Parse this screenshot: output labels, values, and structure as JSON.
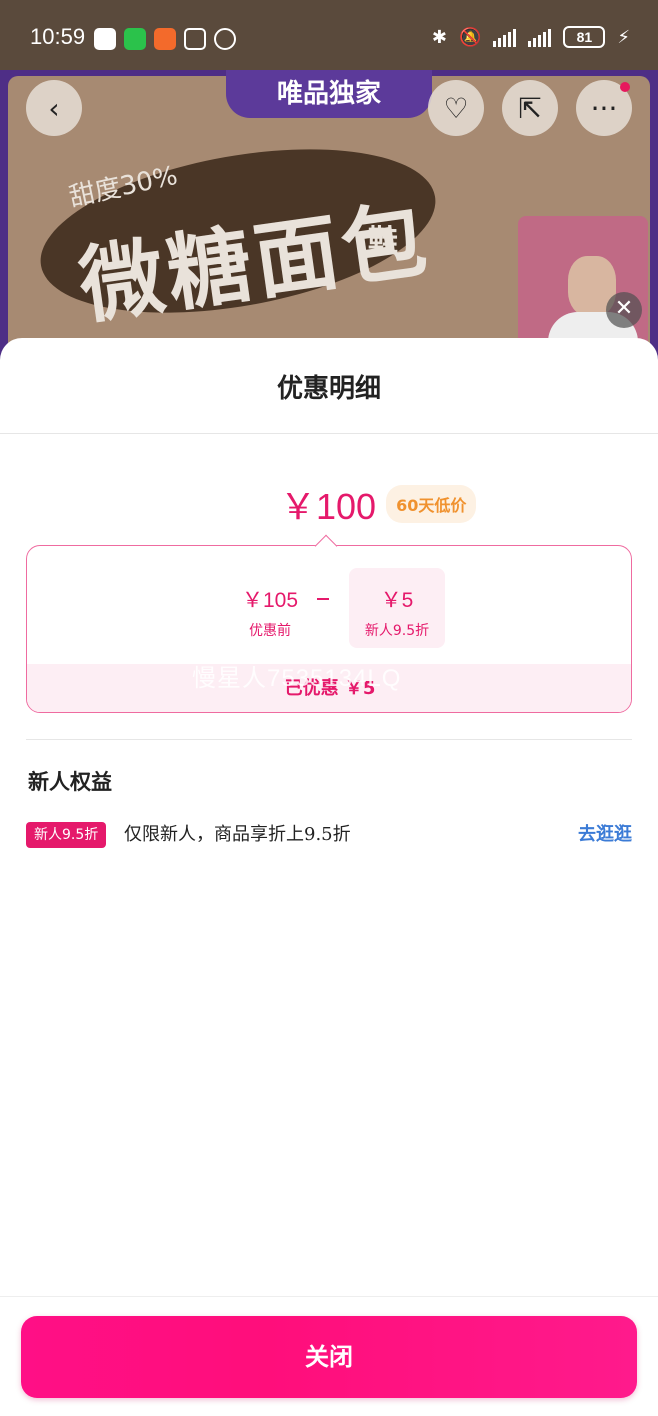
{
  "status_bar": {
    "time": "10:59",
    "battery": "81"
  },
  "banner": {
    "exclusive_label": "唯品独家",
    "title_text": "微糖面包",
    "subtitle_text": "甜度30%",
    "side_text": "鞋"
  },
  "sheet": {
    "title": "优惠明细",
    "final_price": "￥100",
    "low_price_tag": "60天低价",
    "original": {
      "value": "￥105",
      "label": "优惠前"
    },
    "discount": {
      "value": "￥5",
      "label": "新人9.5折"
    },
    "saved": "已优惠 ￥5",
    "watermark": "慢星人7535134LQ"
  },
  "benefits": {
    "section_title": "新人权益",
    "tag": "新人9.5折",
    "text": "仅限新人，商品享折上9.5折",
    "link": "去逛逛"
  },
  "footer": {
    "close_label": "关闭"
  },
  "colors": {
    "accent": "#e5196b",
    "link": "#3b7bd6",
    "tag_bg": "#fdf1e3",
    "tag_text": "#f0922f"
  }
}
